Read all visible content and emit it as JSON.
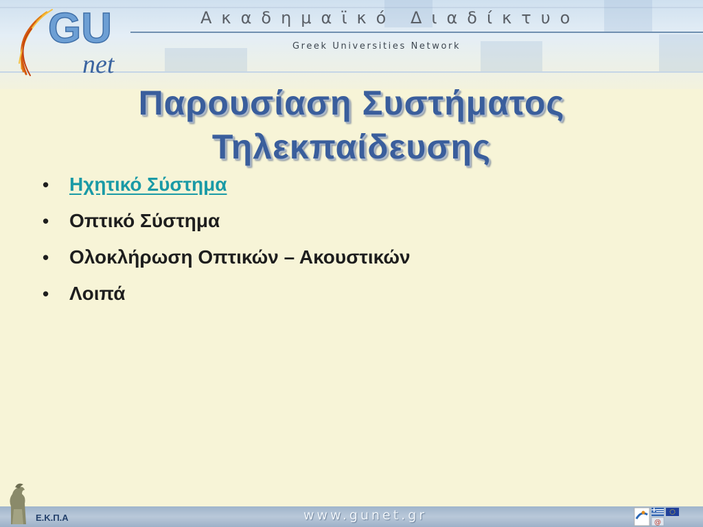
{
  "header": {
    "title": "Ακαδημαϊκό Διαδίκτυο",
    "subtitle": "Greek Universities Network",
    "logo": {
      "primary": "GU",
      "secondary": "net"
    }
  },
  "slide": {
    "title_line1": "Παρουσίαση Συστήματος",
    "title_line2": "Τηλεκπαίδευσης",
    "bullets": [
      {
        "label": "Ηχητικό Σύστημα",
        "is_link": true
      },
      {
        "label": "Οπτικό Σύστημα",
        "is_link": false
      },
      {
        "label": "Ολοκλήρωση Οπτικών – Ακουστικών",
        "is_link": false
      },
      {
        "label": "Λοιπά",
        "is_link": false
      }
    ],
    "bullet_glyph": "•"
  },
  "footer": {
    "org": "Ε.Κ.Π.Α",
    "url": "www.gunet.gr"
  },
  "colors": {
    "background": "#f7f4d7",
    "title": "#3a5e9c",
    "link": "#1a9aa6",
    "text": "#1e1e1e"
  },
  "icons": [
    "gunet-logo",
    "athena-statue-icon",
    "eu-flag-icon",
    "greek-flag-icon",
    "program-badge-icon",
    "email-at-icon"
  ]
}
